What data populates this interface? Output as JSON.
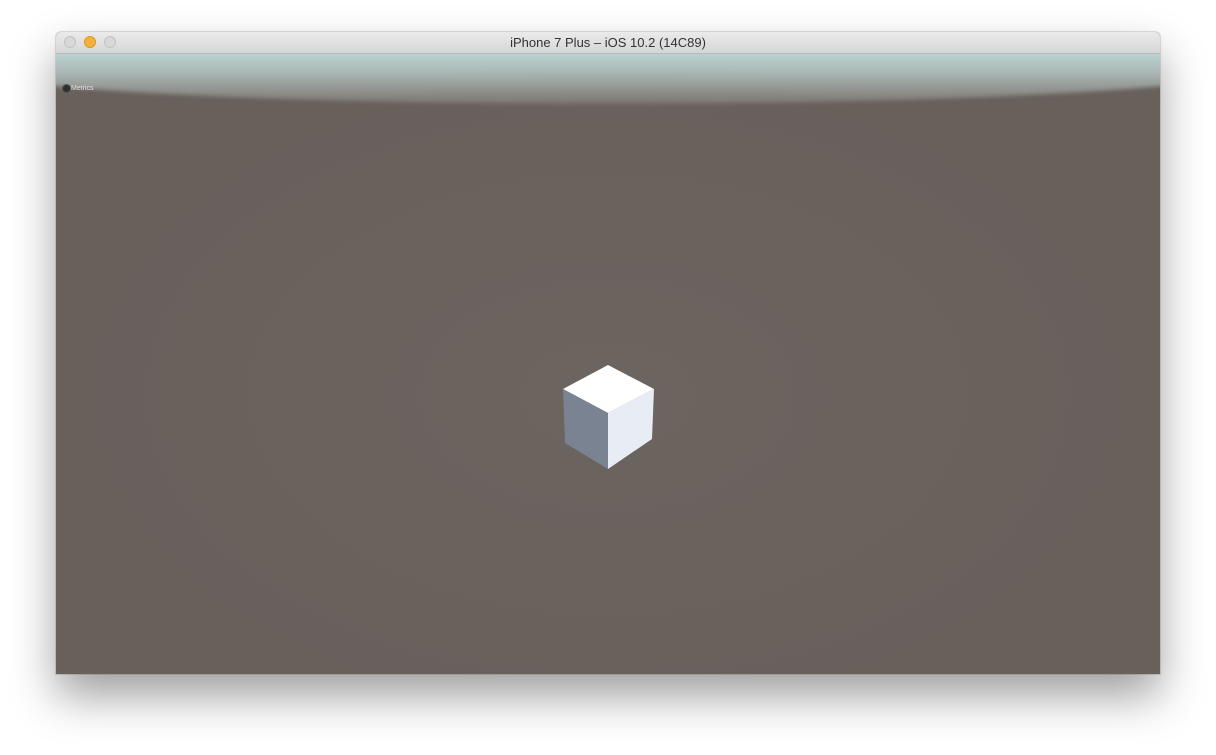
{
  "window": {
    "title": "iPhone 7 Plus – iOS 10.2 (14C89)"
  },
  "scene": {
    "metrics_label": "Metrics",
    "colors": {
      "background": "#68605b",
      "sky": "#cdeeee",
      "cube_top": "#ffffff",
      "cube_left": "#7a8391",
      "cube_right": "#e8edf5"
    }
  }
}
